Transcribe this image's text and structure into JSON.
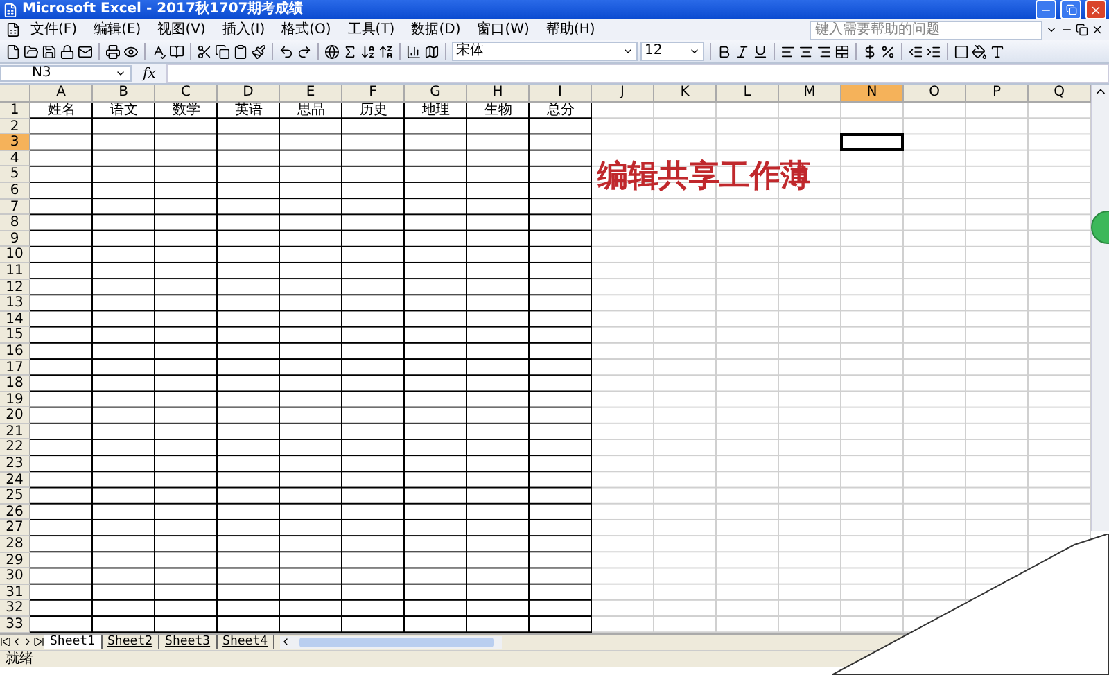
{
  "window": {
    "title": "Microsoft Excel - 2017秋1707期考成绩"
  },
  "menu": [
    "文件(F)",
    "编辑(E)",
    "视图(V)",
    "插入(I)",
    "格式(O)",
    "工具(T)",
    "数据(D)",
    "窗口(W)",
    "帮助(H)"
  ],
  "help": {
    "placeholder": "键入需要帮助的问题"
  },
  "toolbar": {
    "font": "宋体",
    "size": "12"
  },
  "formula_bar": {
    "name_box": "N3",
    "fx": "fx"
  },
  "columns": [
    {
      "label": "A",
      "selected": false
    },
    {
      "label": "B",
      "selected": false
    },
    {
      "label": "C",
      "selected": false
    },
    {
      "label": "D",
      "selected": false
    },
    {
      "label": "E",
      "selected": false
    },
    {
      "label": "F",
      "selected": false
    },
    {
      "label": "G",
      "selected": false
    },
    {
      "label": "H",
      "selected": false
    },
    {
      "label": "I",
      "selected": false
    },
    {
      "label": "J",
      "selected": false
    },
    {
      "label": "K",
      "selected": false
    },
    {
      "label": "L",
      "selected": false
    },
    {
      "label": "M",
      "selected": false
    },
    {
      "label": "N",
      "selected": true
    },
    {
      "label": "O",
      "selected": false
    },
    {
      "label": "P",
      "selected": false
    },
    {
      "label": "Q",
      "selected": false
    }
  ],
  "rows": [
    {
      "label": "1",
      "selected": false,
      "cells": [
        "姓名",
        "语文",
        "数学",
        "英语",
        "思品",
        "历史",
        "地理",
        "生物",
        "总分"
      ]
    },
    {
      "label": "2",
      "selected": false
    },
    {
      "label": "3",
      "selected": true
    },
    {
      "label": "4",
      "selected": false
    },
    {
      "label": "5",
      "selected": false
    },
    {
      "label": "6",
      "selected": false
    },
    {
      "label": "7",
      "selected": false
    },
    {
      "label": "8",
      "selected": false
    },
    {
      "label": "9",
      "selected": false
    },
    {
      "label": "10",
      "selected": false
    },
    {
      "label": "11",
      "selected": false
    },
    {
      "label": "12",
      "selected": false
    },
    {
      "label": "13",
      "selected": false
    },
    {
      "label": "14",
      "selected": false
    },
    {
      "label": "15",
      "selected": false
    },
    {
      "label": "16",
      "selected": false
    },
    {
      "label": "17",
      "selected": false
    },
    {
      "label": "18",
      "selected": false
    },
    {
      "label": "19",
      "selected": false
    },
    {
      "label": "20",
      "selected": false
    },
    {
      "label": "21",
      "selected": false
    },
    {
      "label": "22",
      "selected": false
    },
    {
      "label": "23",
      "selected": false
    },
    {
      "label": "24",
      "selected": false
    },
    {
      "label": "25",
      "selected": false
    },
    {
      "label": "26",
      "selected": false
    },
    {
      "label": "27",
      "selected": false
    },
    {
      "label": "28",
      "selected": false
    },
    {
      "label": "29",
      "selected": false
    },
    {
      "label": "30",
      "selected": false
    },
    {
      "label": "31",
      "selected": false
    },
    {
      "label": "32",
      "selected": false
    },
    {
      "label": "33",
      "selected": false
    }
  ],
  "overlay_text": "编辑共享工作薄",
  "sheet_tabs": [
    {
      "label": "Sheet1",
      "selected": true
    },
    {
      "label": "Sheet2",
      "selected": false
    },
    {
      "label": "Sheet3",
      "selected": false
    },
    {
      "label": "Sheet4",
      "selected": false
    }
  ],
  "status_bar": "就绪"
}
